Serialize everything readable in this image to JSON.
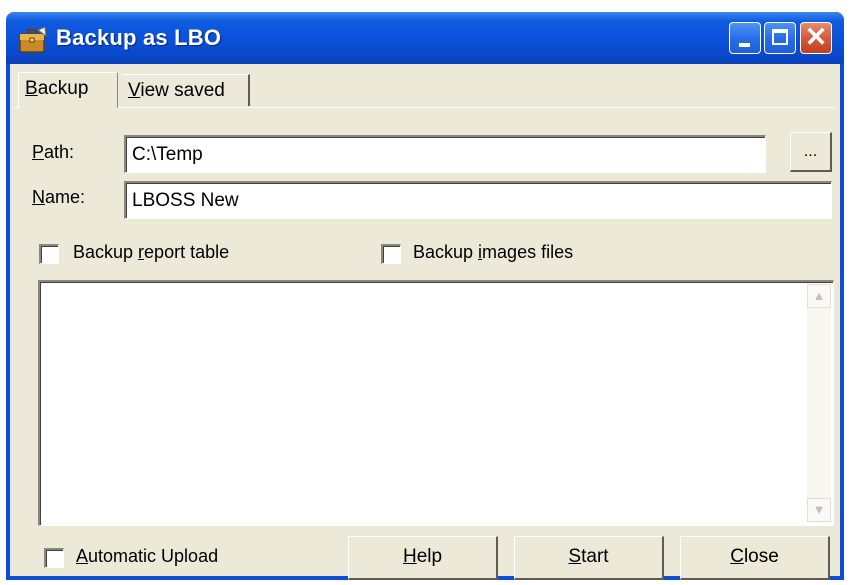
{
  "window": {
    "title": "Backup as LBO",
    "app_icon": "briefcase-icon",
    "minimize_icon": "minimize-icon",
    "maximize_icon": "maximize-icon",
    "close_icon": "close-icon",
    "close_glyph": "✕"
  },
  "tabs": [
    {
      "accel": "B",
      "rest": "ackup",
      "active": true
    },
    {
      "accel": "V",
      "rest": "iew saved",
      "active": false
    }
  ],
  "path": {
    "accel": "P",
    "rest": "ath:",
    "value": "C:\\Temp",
    "browse_label": "..."
  },
  "name": {
    "accel": "N",
    "rest": "ame:",
    "value": "LBOSS New"
  },
  "checkboxes": {
    "report_table": {
      "pre": "Backup ",
      "accel": "r",
      "post": "eport table",
      "checked": false
    },
    "images_files": {
      "pre": "Backup ",
      "accel": "i",
      "post": "mages files",
      "checked": false
    },
    "auto_upload": {
      "pre": "",
      "accel": "A",
      "post": "utomatic Upload",
      "checked": false
    }
  },
  "log": {
    "text": "",
    "scroll_up_glyph": "▲",
    "scroll_down_glyph": "▼"
  },
  "buttons": {
    "help": {
      "accel": "H",
      "rest": "elp"
    },
    "start": {
      "accel": "S",
      "rest": "tart"
    },
    "close": {
      "accel": "C",
      "rest": "lose"
    }
  },
  "colors": {
    "titlebar": "#0a50d8",
    "face": "#ece9d8",
    "close_button": "#d45a3a"
  }
}
